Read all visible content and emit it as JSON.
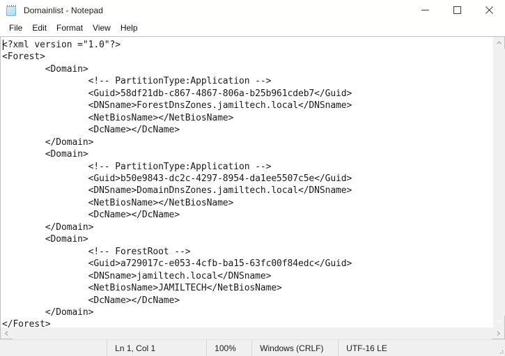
{
  "window": {
    "title": "Domainlist - Notepad",
    "app_icon": "notepad-icon",
    "controls": {
      "minimize": "minimize-button",
      "maximize": "maximize-button",
      "close": "close-button"
    }
  },
  "menubar": {
    "items": [
      {
        "label": "File"
      },
      {
        "label": "Edit"
      },
      {
        "label": "Format"
      },
      {
        "label": "View"
      },
      {
        "label": "Help"
      }
    ]
  },
  "editor": {
    "content": "<?xml version =\"1.0\"?>\n<Forest>\n        <Domain>\n                <!-- PartitionType:Application -->\n                <Guid>58df21db-c867-4867-806a-b25b961cdeb7</Guid>\n                <DNSname>ForestDnsZones.jamiltech.local</DNSname>\n                <NetBiosName></NetBiosName>\n                <DcName></DcName>\n        </Domain>\n        <Domain>\n                <!-- PartitionType:Application -->\n                <Guid>b50e9843-dc2c-4297-8954-da1ee5507c5e</Guid>\n                <DNSname>DomainDnsZones.jamiltech.local</DNSname>\n                <NetBiosName></NetBiosName>\n                <DcName></DcName>\n        </Domain>\n        <Domain>\n                <!-- ForestRoot -->\n                <Guid>a729017c-e053-4cfb-ba15-63fc00f84edc</Guid>\n                <DNSname>jamiltech.local</DNSname>\n                <NetBiosName>JAMILTECH</NetBiosName>\n                <DcName></DcName>\n        </Domain>\n</Forest>"
  },
  "statusbar": {
    "cursor_position": "Ln 1, Col 1",
    "zoom": "100%",
    "line_ending": "Windows (CRLF)",
    "encoding": "UTF-16 LE"
  },
  "scrollbars": {
    "vertical_up": "scroll-up-arrow",
    "vertical_down": "scroll-down-arrow",
    "horizontal_left": "scroll-left-arrow",
    "horizontal_right": "scroll-right-arrow"
  },
  "colors": {
    "titlebar_bg": "#fffffe",
    "chrome_bg": "#f0f0f0",
    "text": "#1a1a1a",
    "border": "#bfbfbf",
    "close_hover": "#e81123"
  }
}
